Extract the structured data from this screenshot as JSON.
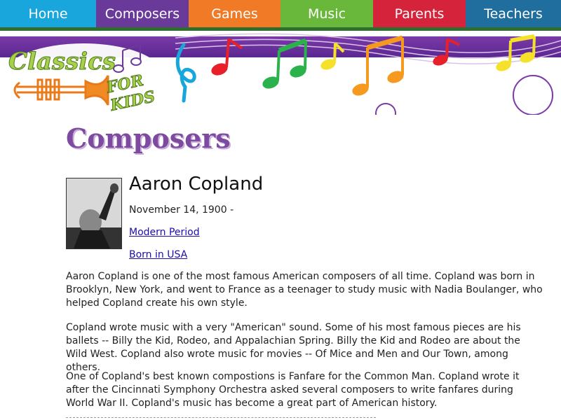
{
  "nav": {
    "items": [
      {
        "label": "Home",
        "color": "#19a6dc"
      },
      {
        "label": "Composers",
        "color": "#6a3a9a"
      },
      {
        "label": "Games",
        "color": "#f07a26"
      },
      {
        "label": "Music",
        "color": "#69b83b"
      },
      {
        "label": "Parents",
        "color": "#d4233a"
      },
      {
        "label": "Teachers",
        "color": "#1f6e9e"
      }
    ]
  },
  "logo": {
    "text_main": "Classics",
    "text_sub": "FOR KIDS"
  },
  "page": {
    "heading": "Composers"
  },
  "composer": {
    "name": "Aaron Copland",
    "dates": "November 14, 1900 -",
    "period_link": "Modern Period",
    "born_link": "Born in USA"
  },
  "body": {
    "p1": "Aaron Copland is one of the most famous American composers of all time. Copland was born in Brooklyn, New York, and went to France as a teenager to study music with Nadia Boulanger, who helped Copland create his own style.",
    "p2": "Copland wrote music with a very \"American\" sound. Some of his most famous pieces are his ballets -- Billy the Kid, Rodeo, and Appalachian Spring. Billy the Kid and Rodeo are about the Wild West. Copland also wrote music for movies -- Of Mice and Men and Our Town, among others.",
    "p3": "One of Copland's best known compostions is Fanfare for the Common Man. Copland wrote it after the Cincinnati Symphony Orchestra asked several composers to write fanfares during World War II. Copland's music has become a great part of American history."
  }
}
